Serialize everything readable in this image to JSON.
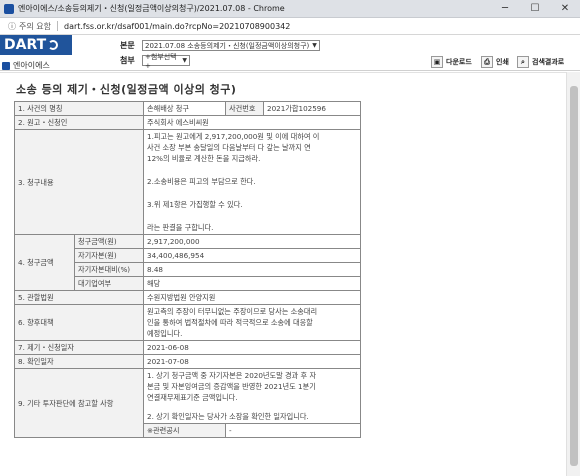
{
  "window": {
    "title": "엔아이에스/소송등의제기・신청(일정금액이상의청구)/2021.07.08 - Chrome",
    "minimize": "─",
    "maximize": "☐",
    "close": "✕"
  },
  "address_bar": {
    "insecure_label": "주의 요함",
    "url": "dart.fss.or.kr/dsaf001/main.do?rcpNo=20210708900342"
  },
  "header": {
    "logo_text": "DART",
    "report_label": "본문",
    "report_select": "2021.07.08 소송등의제기・신청(일정금액이상의청구)",
    "attach_label": "첨부",
    "attach_select": "+첨부선택+",
    "download_label": "다운로드",
    "print_label": "인쇄",
    "search_label": "검색결과로"
  },
  "company": {
    "name": "엔아이에스"
  },
  "document": {
    "title": "소송 등의 제기・신청(일정금액 이상의 청구)",
    "rows": {
      "r1_label": "1. 사건의 명칭",
      "r1_value": "손해배상 청구",
      "r1_sub_label": "사건번호",
      "r1_sub_value": "2021가합102596",
      "r2_label": "2. 원고・신청인",
      "r2_value": "주식회사 에스비씨원",
      "r3_label": "3. 청구내용",
      "r3_line1": "1.피고는 원고에게 2,917,200,000원 및 이에 대하여 이",
      "r3_line2": "사건 소장 부본 송달일의 다음날부터 다 갚는 날까지 연",
      "r3_line3": "12%의 비율로 계산한 돈을 지급하라.",
      "r3_line4": "2.소송비용은 피고의 부담으로 한다.",
      "r3_line5": "3.위 제1항은 가집행할 수 있다.",
      "r3_line6": "라는 판결을 구합니다.",
      "r4_label": "4. 청구금액",
      "r4a_label": "청구금액(원)",
      "r4a_value": "2,917,200,000",
      "r4b_label": "자기자본(원)",
      "r4b_value": "34,400,486,954",
      "r4c_label": "자기자본대비(%)",
      "r4c_value": "8.48",
      "r4d_label": "대기업여부",
      "r4d_value": "해당",
      "r5_label": "5. 관할법원",
      "r5_value": "수원지방법원 안양지원",
      "r6_label": "6. 향후대책",
      "r6_line1": "원고측의 주장이 터무니없는 주장이므로 당사는 소송대리",
      "r6_line2": "인을 통하여 법적절차에 따라 적극적으로 소송에 대응할",
      "r6_line3": "예정입니다.",
      "r7_label": "7. 제기・신청일자",
      "r7_value": "2021-06-08",
      "r8_label": "8. 확인일자",
      "r8_value": "2021-07-08",
      "r9_label": "9. 기타 투자판단에 참고할 사항",
      "r9_line1": "1. 상기 청구금액 중 자기자본은 2020년도말 경과 후 자",
      "r9_line2": "본금 및 자본잉여금의 증감액을 반영한 2021년도 1분기",
      "r9_line3": "연결재무제표기준 금액입니다.",
      "r9_line4": "2. 상기 확인일자는 당사가 소장을 확인한 일자입니다.",
      "r9_related_label": "※관련공시",
      "r9_related_value": "-"
    }
  }
}
